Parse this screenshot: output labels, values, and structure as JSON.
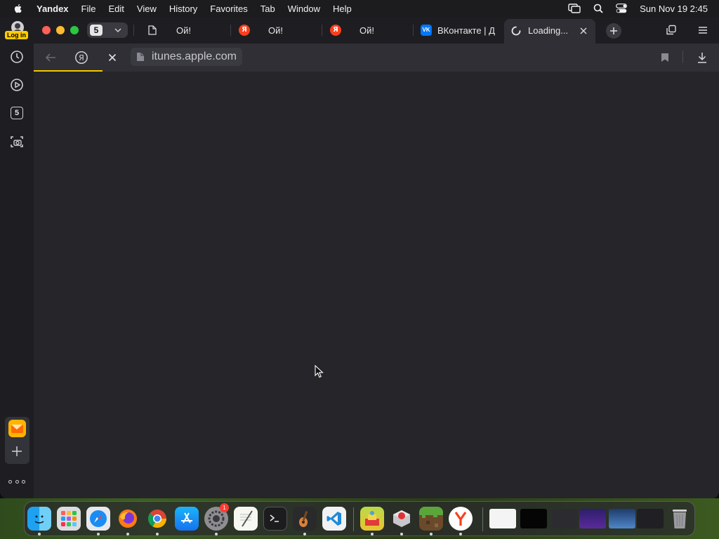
{
  "menubar": {
    "app_name": "Yandex",
    "items": [
      "File",
      "Edit",
      "View",
      "History",
      "Favorites",
      "Tab",
      "Window",
      "Help"
    ],
    "clock": "Sun Nov 19  2:45"
  },
  "sidebar": {
    "login_label": "Log in",
    "tab_count": "5"
  },
  "tabbar": {
    "tab_count": "5",
    "tabs": [
      {
        "label": "Ой!",
        "icon": "document-icon"
      },
      {
        "label": "Ой!",
        "icon": "yandex-icon"
      },
      {
        "label": "Ой!",
        "icon": "yandex-icon"
      },
      {
        "label": "ВКонтакте | Д",
        "icon": "vk-icon"
      },
      {
        "label": "Loading...",
        "icon": "loading-spinner-icon",
        "active": true
      }
    ],
    "yandex_letter": "Я",
    "vk_letters": "VK"
  },
  "toolbar": {
    "url": "itunes.apple.com",
    "load_progress": 0.1
  },
  "dock": {
    "apps": [
      "Finder",
      "Launchpad",
      "Safari",
      "Firefox",
      "Chrome",
      "App Store",
      "System Settings",
      "TextEdit",
      "Terminal",
      "GarageBand",
      "Visual Studio Code",
      "Game 1",
      "Game 2",
      "Minecraft",
      "Yandex Browser"
    ],
    "settings_badge": "1"
  },
  "colors": {
    "accent": "#f5c800",
    "yandex_red": "#fc3f1d",
    "vk_blue": "#0077ff",
    "window_bg": "#26262b"
  }
}
